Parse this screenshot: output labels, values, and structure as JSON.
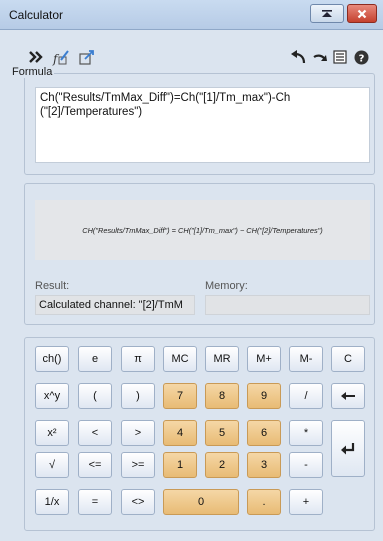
{
  "window": {
    "title": "Calculator"
  },
  "formula": {
    "legend": "Formula",
    "text": "Ch(\"Results/TmMax_Diff\")=Ch(\"[1]/Tm_max\")-Ch\n(\"[2]/Temperatures\")"
  },
  "preview": {
    "text": "CH(\"Results/TmMax_Diff\") = CH(\"[1]/Tm_max\") − CH(\"[2]/Temperatures\")"
  },
  "result": {
    "label": "Result:",
    "value": "Calculated channel: \"[2]/TmM"
  },
  "memory": {
    "label": "Memory:",
    "value": ""
  },
  "keys": {
    "ch": "ch()",
    "e": "e",
    "pi": "π",
    "mc": "MC",
    "mr": "MR",
    "mplus": "M+",
    "mminus": "M-",
    "clear": "C",
    "pow": "x^y",
    "lparen": "(",
    "rparen": ")",
    "n7": "7",
    "n8": "8",
    "n9": "9",
    "div": "/",
    "sq": "x²",
    "lt": "<",
    "gt": ">",
    "n4": "4",
    "n5": "5",
    "n6": "6",
    "mul": "*",
    "sqrt": "√",
    "le": "<=",
    "ge": ">=",
    "n1": "1",
    "n2": "2",
    "n3": "3",
    "minus": "-",
    "recip": "1/x",
    "eq": "=",
    "ne": "<>",
    "n0": "0",
    "dot": ".",
    "plus": "+"
  },
  "icons": {
    "expand": "double-chevron-right-icon",
    "formula_editor": "function-edit-icon",
    "export": "export-icon",
    "undo": "undo-icon",
    "redo": "redo-icon",
    "list": "list-icon",
    "help": "help-icon",
    "backspace": "backspace-arrow-icon",
    "enter": "enter-return-icon"
  },
  "colors": {
    "numeric_key": "#e8bb75",
    "titlebar": "#c9dbf0",
    "close_button": "#c5412f"
  }
}
